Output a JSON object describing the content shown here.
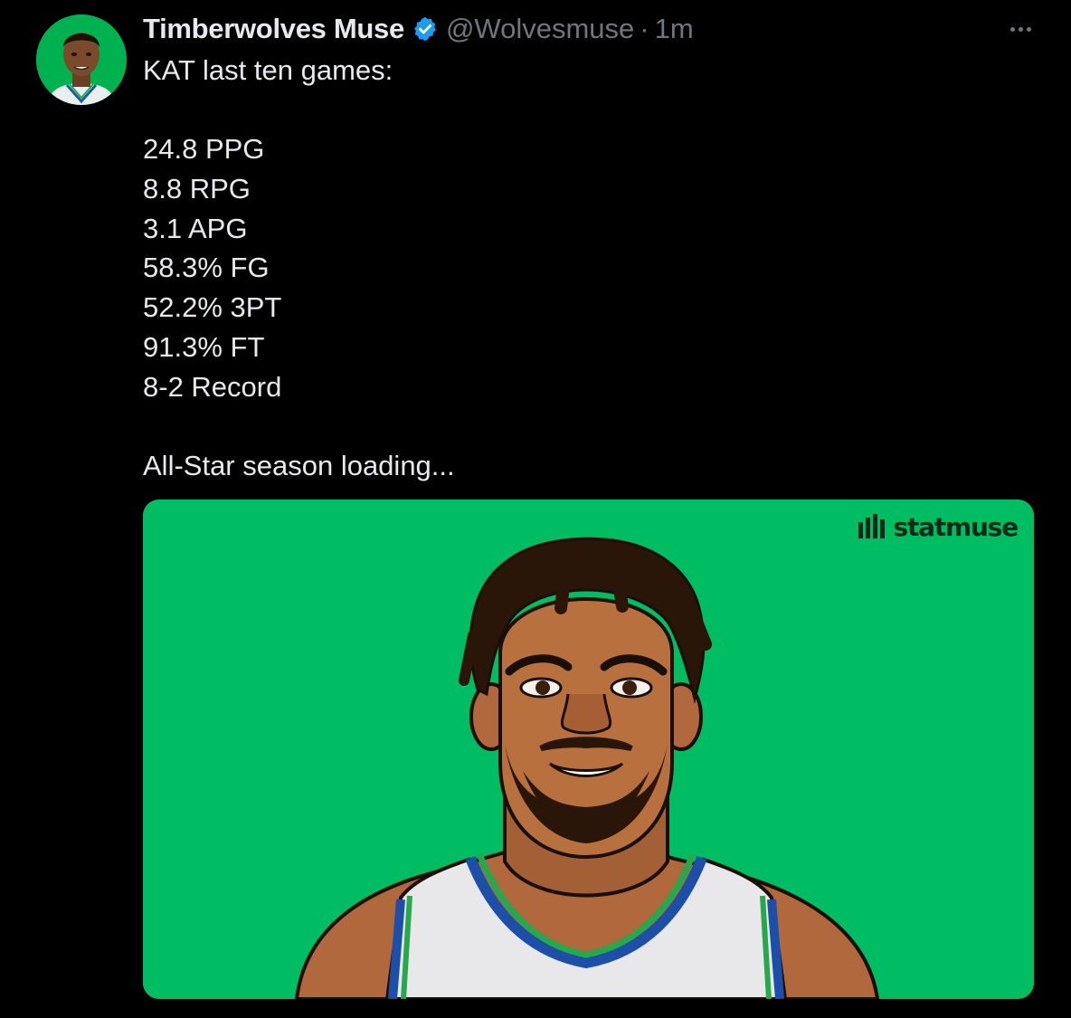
{
  "tweet": {
    "author": {
      "display_name": "Timberwolves Muse",
      "handle": "@Wolvesmuse",
      "verified": true,
      "avatar": "avatar-image"
    },
    "separator": "·",
    "time": "1m",
    "more_icon": "more-horizontal-icon",
    "lines": [
      "KAT last ten games:",
      "",
      "24.8 PPG",
      "8.8 RPG",
      "3.1 APG",
      "58.3% FG",
      "52.2% 3PT",
      "91.3% FT",
      "8-2 Record",
      "",
      "All-Star season loading..."
    ],
    "media": {
      "watermark": "statmuse",
      "background": "#00bd63"
    }
  },
  "colors": {
    "background": "#000000",
    "text": "#e7e9ea",
    "secondary": "#71767b",
    "verified": "#1d9bf0"
  }
}
